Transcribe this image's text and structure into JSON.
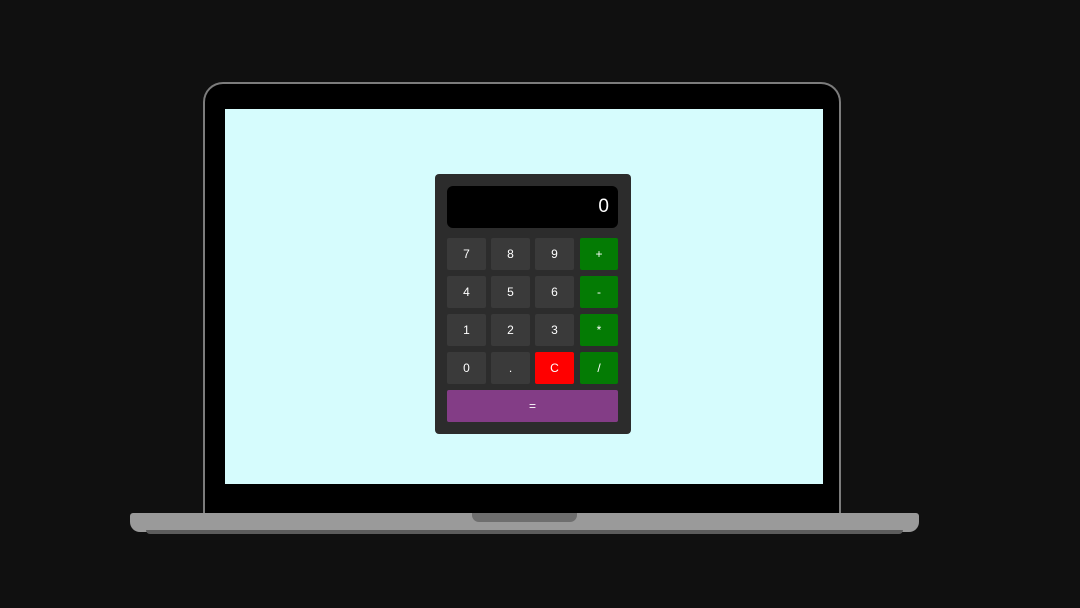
{
  "display": {
    "value": "0"
  },
  "keys": {
    "seven": "7",
    "eight": "8",
    "nine": "9",
    "plus": "+",
    "four": "4",
    "five": "5",
    "six": "6",
    "minus": "-",
    "one": "1",
    "two": "2",
    "three": "3",
    "multiply": "*",
    "zero": "0",
    "decimal": ".",
    "clear": "C",
    "divide": "/",
    "equals": "="
  },
  "colors": {
    "background": "#101010",
    "screen": "#d6fcfd",
    "calculator_body": "#2c2c2c",
    "display": "#000000",
    "digit_key": "#3a3a3a",
    "operator_key": "#047b04",
    "clear_key": "#ff0000",
    "equals_key": "#833d86"
  }
}
